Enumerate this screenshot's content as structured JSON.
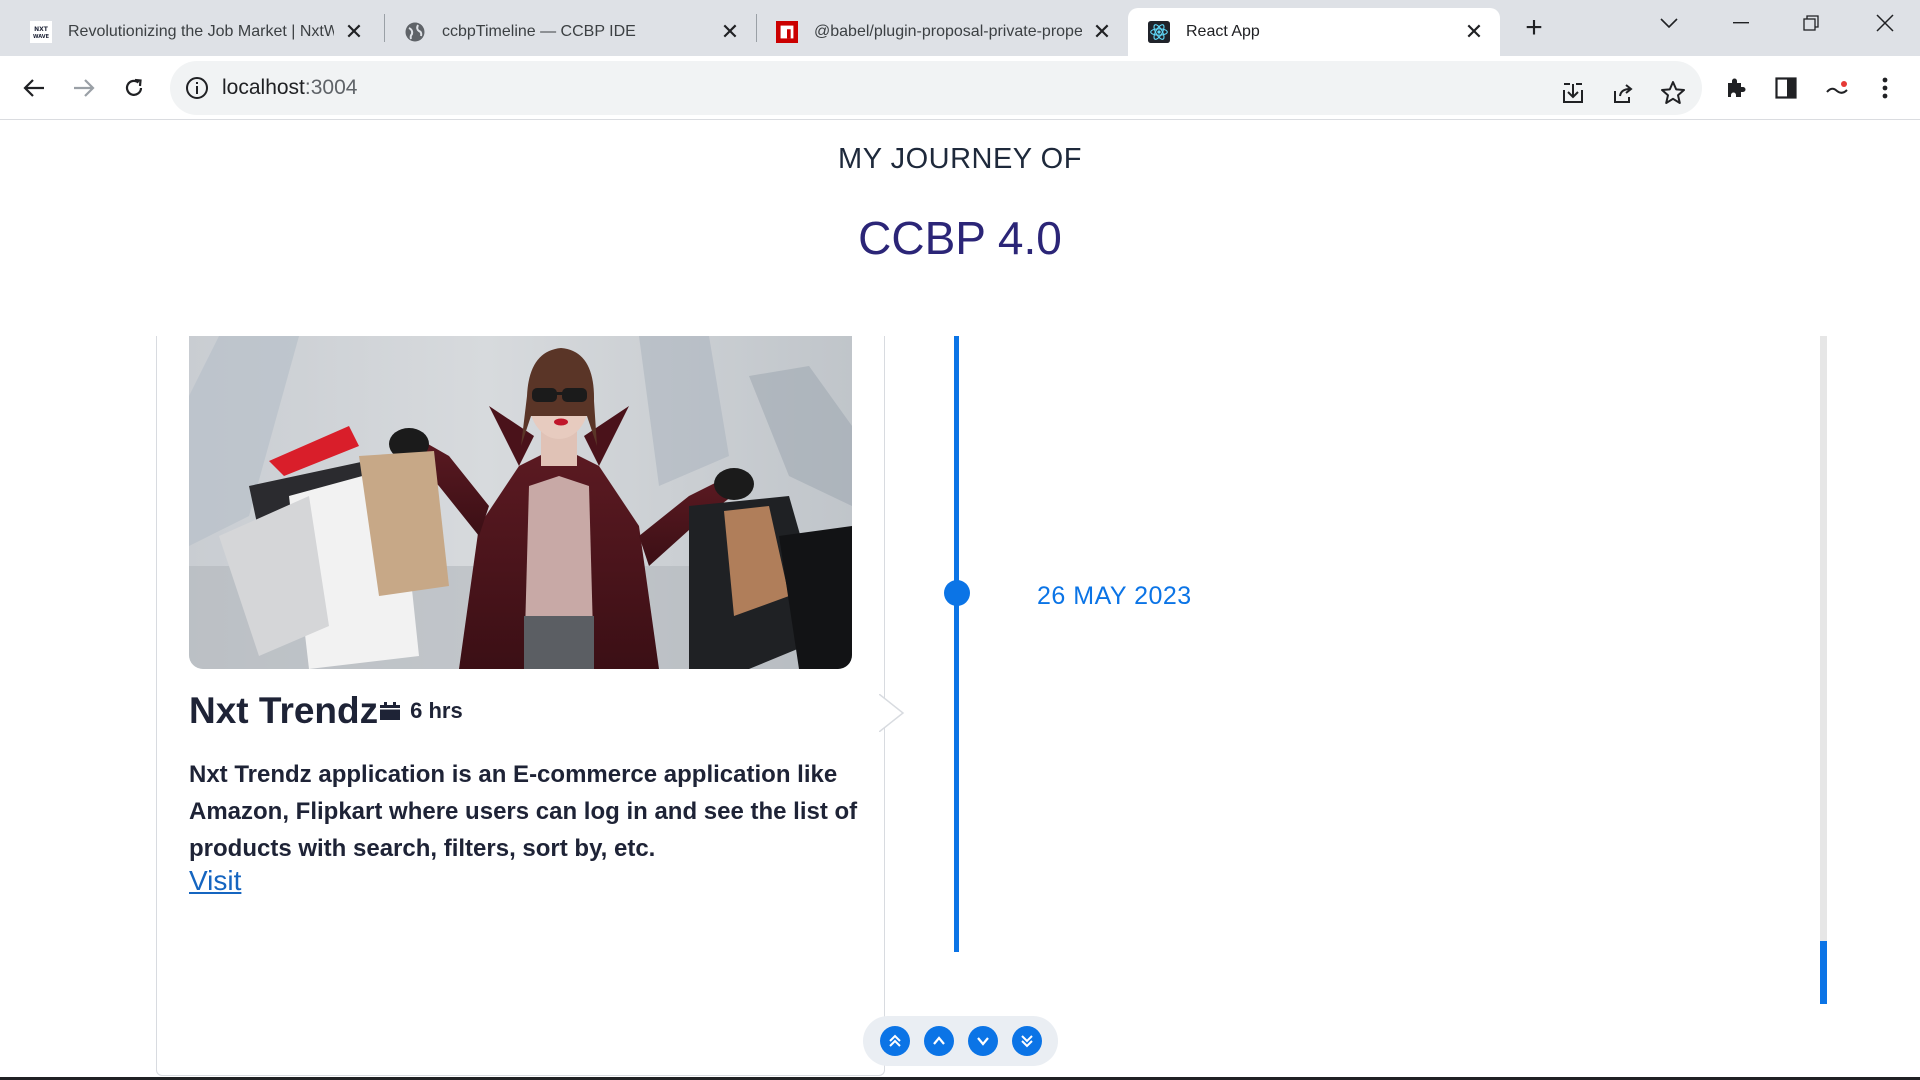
{
  "browser": {
    "tabs": [
      {
        "title": "Revolutionizing the Job Market | NxtWa",
        "favicon": "nxtwave-logo-icon",
        "active": false
      },
      {
        "title": "ccbpTimeline — CCBP IDE",
        "favicon": "globe-icon",
        "active": false
      },
      {
        "title": "@babel/plugin-proposal-private-prope",
        "favicon": "npm-icon",
        "active": false
      },
      {
        "title": "React App",
        "favicon": "react-icon",
        "active": true
      }
    ],
    "favicon_text": {
      "nxtwave": "NXT WAVE"
    },
    "address": {
      "host": "localhost",
      "port": ":3004"
    }
  },
  "page": {
    "subtitle": "MY JOURNEY OF",
    "title": "CCBP 4.0",
    "timeline": {
      "date": "26 MAY 2023",
      "project": {
        "name": "Nxt Trendz",
        "duration": "6 hrs",
        "description": "Nxt Trendz application is an E-commerce application like Amazon, Flipkart where users can log in and see the list of products with search, filters, sort by, etc.",
        "link_label": "Visit"
      }
    },
    "controls": [
      "double-chevron-up-icon",
      "chevron-up-icon",
      "chevron-down-icon",
      "double-chevron-down-icon"
    ]
  },
  "colors": {
    "accent": "#0b74e6",
    "title": "#2b2577",
    "text": "#1e2336",
    "link": "#1565c0"
  }
}
